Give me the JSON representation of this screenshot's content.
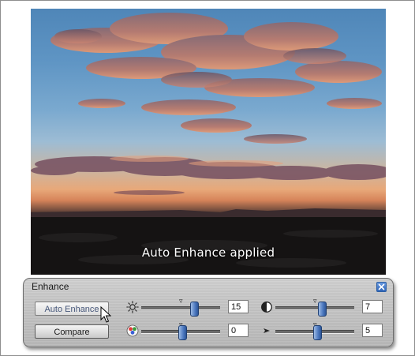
{
  "photo": {
    "caption": "Auto Enhance applied"
  },
  "panel": {
    "title": "Enhance",
    "close_icon": "close-x-icon",
    "buttons": {
      "auto_enhance": "Auto Enhance",
      "compare": "Compare"
    },
    "sliders": [
      {
        "id": "brightness",
        "icon": "sun-icon",
        "value": "15",
        "level": 0.57
      },
      {
        "id": "contrast",
        "icon": "contrast-icon",
        "value": "7",
        "level": 0.55
      },
      {
        "id": "color",
        "icon": "color-dots-icon",
        "value": "0",
        "level": 0.5
      },
      {
        "id": "sharpness",
        "icon": "sharpness-arrow-icon",
        "value": "5",
        "level": 0.52
      }
    ],
    "accent": "#3a66ad"
  }
}
